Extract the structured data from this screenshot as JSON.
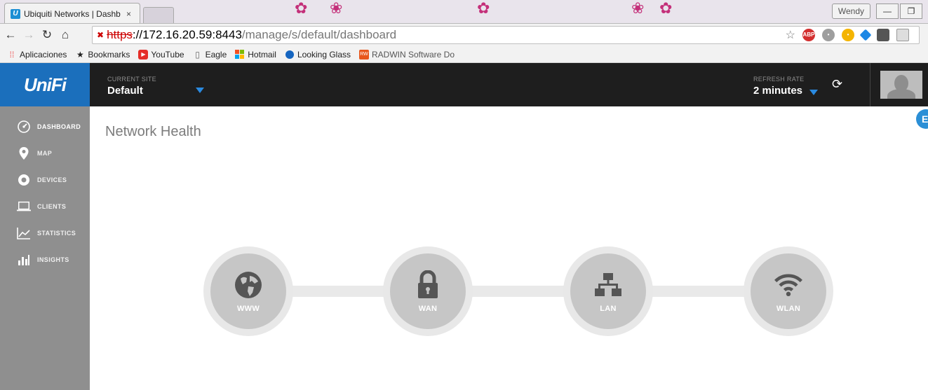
{
  "browser": {
    "tab_title": "Ubiquiti Networks | Dashb",
    "tab_close": "×",
    "user_name": "Wendy",
    "url": {
      "scheme": "https",
      "host_port": "://172.16.20.59:8443",
      "path": "/manage/s/default/dashboard"
    },
    "bookmarks": [
      {
        "label": "Aplicaciones",
        "icon": "apps-grid-icon",
        "color": "#e44"
      },
      {
        "label": "Bookmarks",
        "icon": "star-icon",
        "color": "#444"
      },
      {
        "label": "YouTube",
        "icon": "youtube-icon",
        "color": "#e52d27"
      },
      {
        "label": "Eagle",
        "icon": "page-icon",
        "color": "#666"
      },
      {
        "label": "Hotmail",
        "icon": "windows-icon",
        "color": "#f25022"
      },
      {
        "label": "Looking Glass",
        "icon": "globe-icon",
        "color": "#1565c0"
      },
      {
        "label": "RADWIN Software Do",
        "icon": "radwin-icon",
        "color": "#e8561b"
      }
    ]
  },
  "header": {
    "logo": "UniFi",
    "site_label": "CURRENT SITE",
    "site_value": "Default",
    "refresh_label": "REFRESH RATE",
    "refresh_value": "2 minutes"
  },
  "sidebar": {
    "items": [
      {
        "label": "DASHBOARD",
        "icon": "dashboard-icon",
        "active": true
      },
      {
        "label": "MAP",
        "icon": "map-pin-icon",
        "active": false
      },
      {
        "label": "DEVICES",
        "icon": "devices-icon",
        "active": false
      },
      {
        "label": "CLIENTS",
        "icon": "laptop-icon",
        "active": false
      },
      {
        "label": "STATISTICS",
        "icon": "statistics-icon",
        "active": false
      },
      {
        "label": "INSIGHTS",
        "icon": "insights-icon",
        "active": false
      }
    ]
  },
  "main": {
    "title": "Network Health",
    "health_nodes": [
      {
        "label": "WWW",
        "icon": "globe-icon"
      },
      {
        "label": "WAN",
        "icon": "lock-icon"
      },
      {
        "label": "LAN",
        "icon": "network-icon"
      },
      {
        "label": "WLAN",
        "icon": "wifi-icon"
      }
    ]
  },
  "colors": {
    "brand_blue": "#1b6fbc",
    "header_bg": "#1e1e1e",
    "sidebar_bg": "#8f8f8f",
    "node_gray": "#c6c6c6",
    "accent_caret": "#2a8ae0"
  }
}
